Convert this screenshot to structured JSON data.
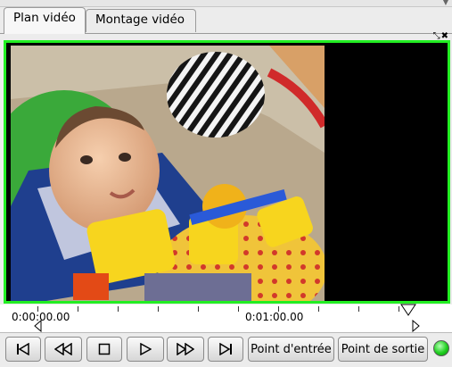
{
  "tabs": [
    {
      "label": "Plan vidéo",
      "active": true
    },
    {
      "label": "Montage vidéo",
      "active": false
    }
  ],
  "viewer": {
    "border_color": "#22ee22",
    "content": "video-frame"
  },
  "timeline": {
    "labels": [
      "0:00:00.00",
      "0:01:00.00"
    ],
    "markers": [
      "out-point-marker",
      "in-point-marker"
    ]
  },
  "controls": {
    "buttons": [
      {
        "icon": "skip-to-start-icon"
      },
      {
        "icon": "rewind-icon"
      },
      {
        "icon": "stop-icon"
      },
      {
        "icon": "play-icon"
      },
      {
        "icon": "fast-forward-icon"
      },
      {
        "icon": "skip-to-end-icon"
      }
    ],
    "in_point_label": "Point d'entrée",
    "out_point_label": "Point de sortie",
    "status_led_color": "#1fcf1f"
  }
}
